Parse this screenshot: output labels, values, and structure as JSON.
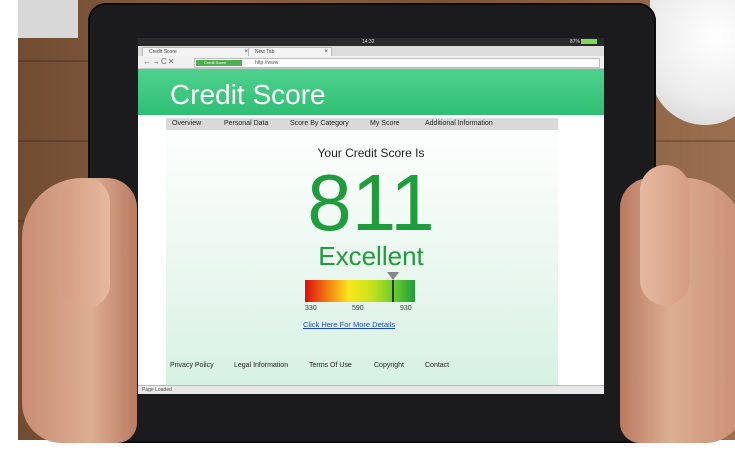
{
  "statusbar": {
    "clock": "14:32",
    "battery": "87%"
  },
  "browser": {
    "tabs": [
      {
        "label": "Credit Score"
      },
      {
        "label": "New Tab"
      }
    ],
    "secure_label": "Credit Score",
    "url": "http://www",
    "status": "Page Loaded"
  },
  "page": {
    "banner_title": "Credit Score",
    "nav": [
      "Overview",
      "Personal Data",
      "Score By Category",
      "My Score",
      "Additional Information"
    ],
    "heading": "Your Credit Score Is",
    "score": "811",
    "rating": "Excellent",
    "gauge": {
      "min": "330",
      "mid": "590",
      "max": "930",
      "value": 811,
      "range": [
        330,
        930
      ]
    },
    "details_link": "Click Here For More Details",
    "footer": [
      "Privacy Policy",
      "Legal Information",
      "Terms Of Use",
      "Copyright",
      "Contact"
    ]
  },
  "colors": {
    "accent": "#2fbf73",
    "score": "#1f9c3c",
    "link": "#1a47c6"
  }
}
